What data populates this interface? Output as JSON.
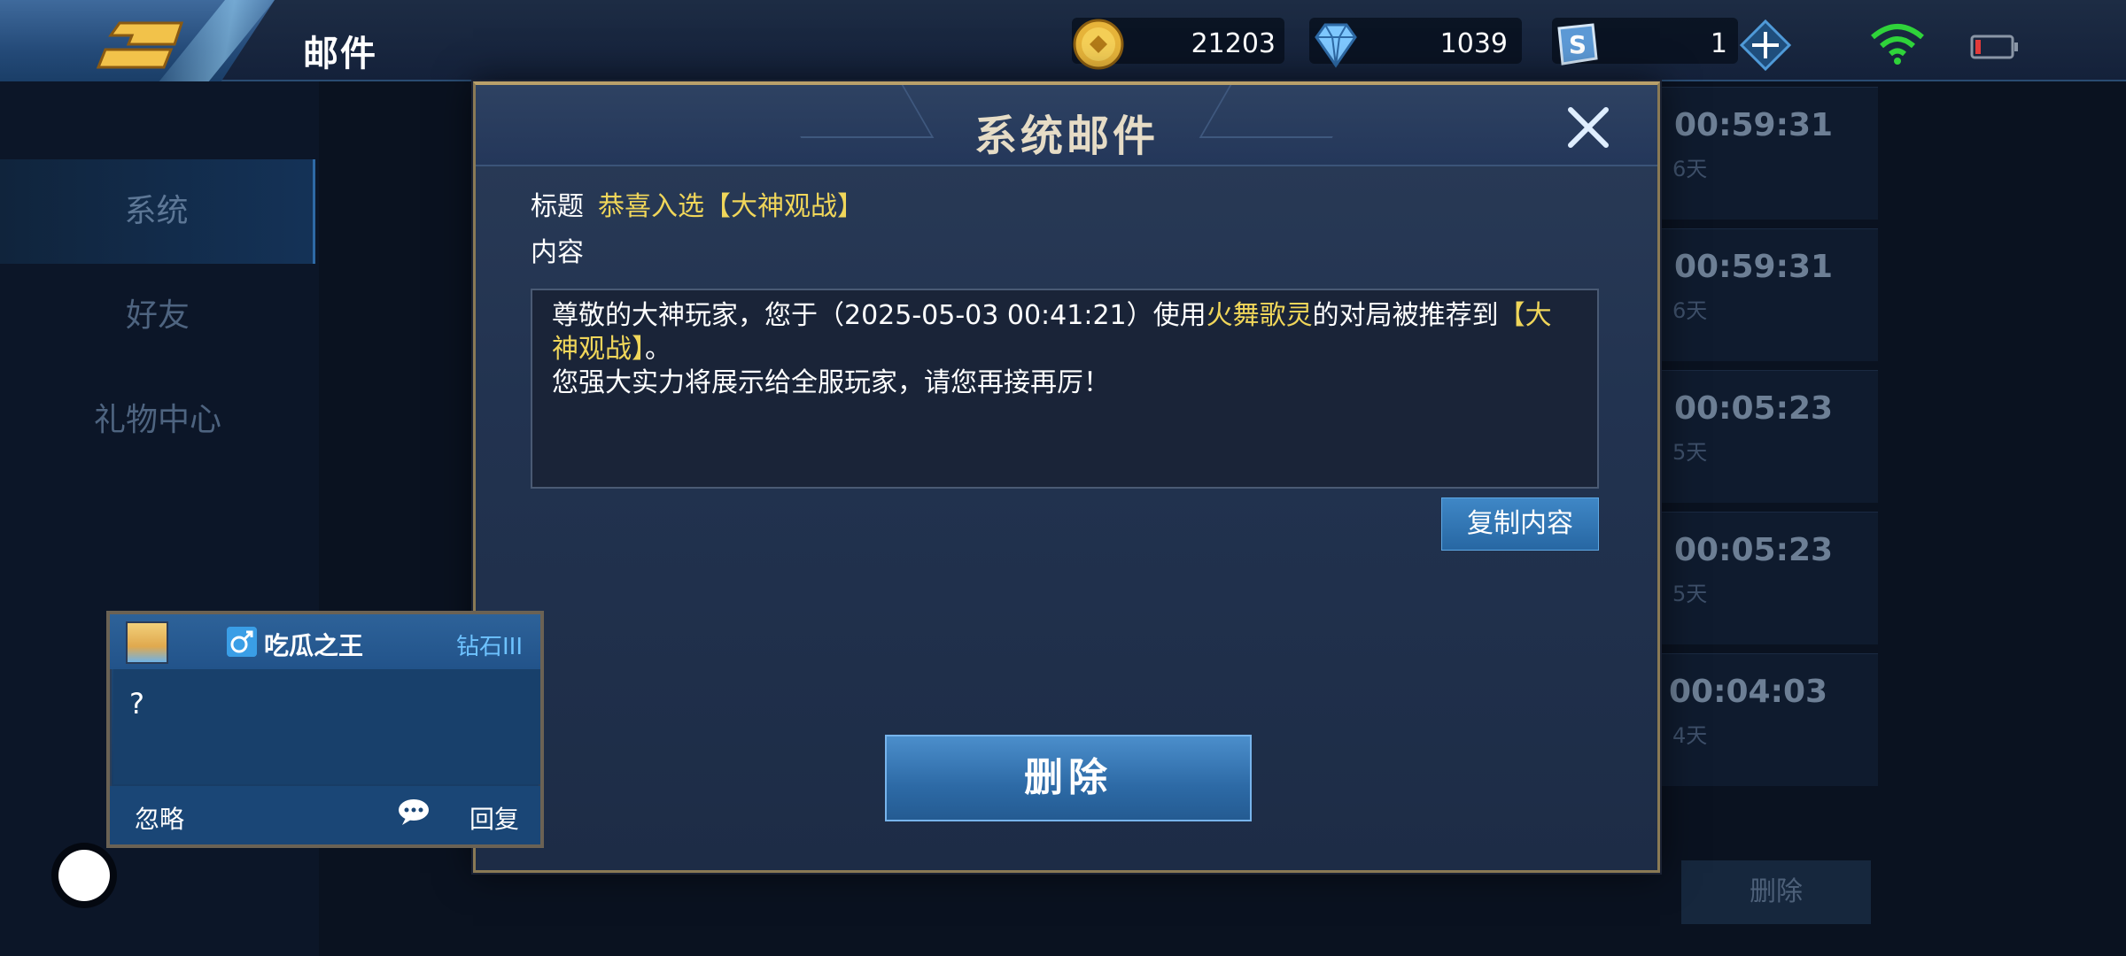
{
  "header": {
    "title": "邮件",
    "gold": "21203",
    "diamonds": "1039",
    "tickets": "1"
  },
  "left_tabs": [
    "系统",
    "好友",
    "礼物中心"
  ],
  "mail_list": [
    {
      "time": "00:59:31",
      "days": "6天",
      "edge": "3"
    },
    {
      "time": "00:59:31",
      "days": "6天",
      "edge": "3"
    },
    {
      "time": "00:05:23",
      "days": "5天",
      "edge": "2"
    },
    {
      "time": "00:05:23",
      "days": "5天",
      "edge": "2"
    },
    {
      "time": "00:04:03",
      "days": "4天",
      "edge": ""
    }
  ],
  "bg_delete_label": "删除",
  "dialog": {
    "title": "系统邮件",
    "subject_label": "标题",
    "subject_value": "恭喜入选【大神观战】",
    "content_label": "内容",
    "content_part1": "尊敬的大神玩家，您于（2025-05-03 00:41:21）使用",
    "content_hero": "火舞歌灵",
    "content_part2": "的对局被推荐到",
    "content_highlight": "【大神观战】",
    "content_part3": "。",
    "content_line2": "您强大实力将展示给全服玩家，请您再接再厉！",
    "copy_label": "复制内容",
    "delete_label": "删除"
  },
  "chat": {
    "name": "吃瓜之王",
    "rank": "钻石III",
    "message": "?",
    "ignore_label": "忽略",
    "reply_label": "回复"
  },
  "colors": {
    "highlight": "#f0d65a",
    "button_blue": "#2d6aa6",
    "frame_gold": "#b9a06a"
  }
}
